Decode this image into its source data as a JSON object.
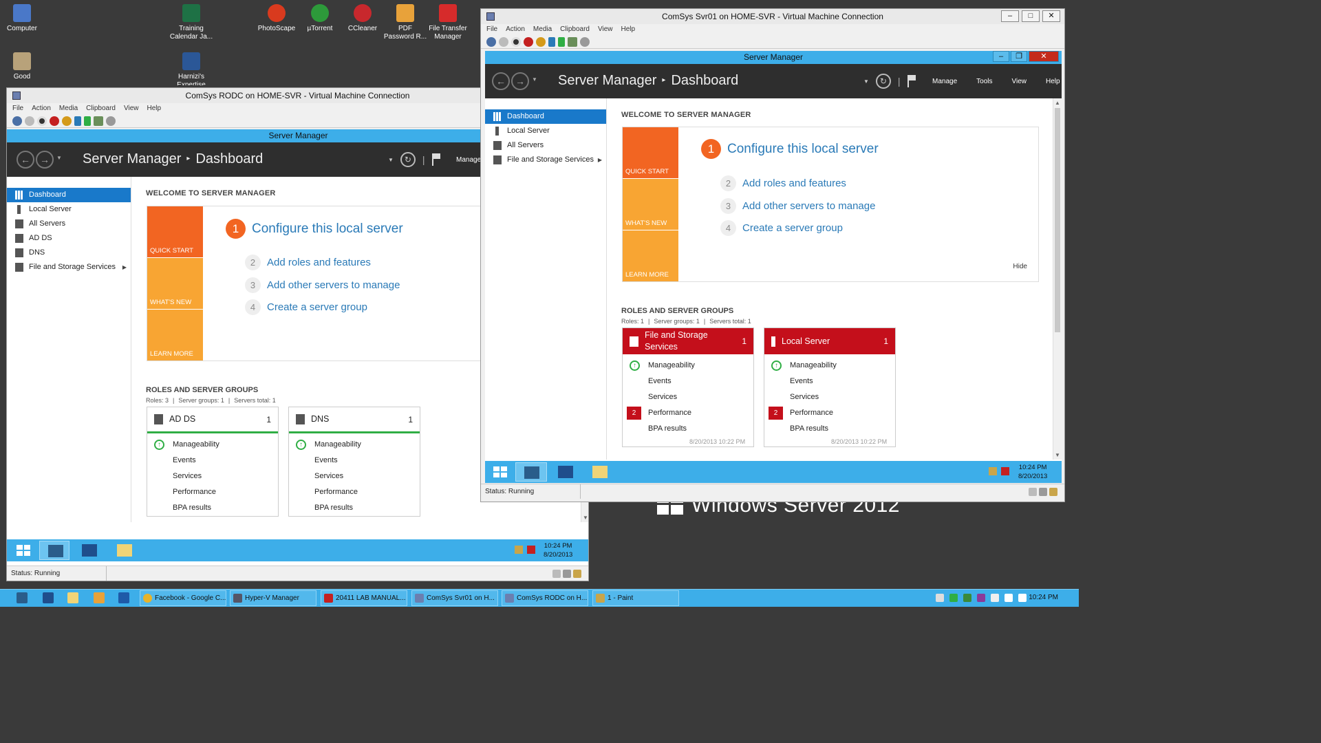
{
  "desktop": {
    "icons": [
      {
        "label": "Computer",
        "icon": "computer-icon"
      },
      {
        "label": "Training Calendar Ja...",
        "icon": "excel-file-icon"
      },
      {
        "label": "PhotoScape",
        "icon": "photoscape-icon"
      },
      {
        "label": "µTorrent",
        "icon": "utorrent-icon"
      },
      {
        "label": "CCleaner",
        "icon": "ccleaner-icon"
      },
      {
        "label": "PDF Password R...",
        "icon": "pdf-password-icon"
      },
      {
        "label": "File Transfer Manager",
        "icon": "file-transfer-icon"
      },
      {
        "label": "Good",
        "icon": "notepad-icon"
      },
      {
        "label": "Harnizi's Expertise",
        "icon": "word-file-icon"
      }
    ],
    "watermark": "Windows Server 2012"
  },
  "vm_left": {
    "title": "ComSys RODC on HOME-SVR - Virtual Machine Connection",
    "menu": [
      "File",
      "Action",
      "Media",
      "Clipboard",
      "View",
      "Help"
    ],
    "status": "Status: Running",
    "sm": {
      "title": "Server Manager",
      "breadcrumb_app": "Server Manager",
      "breadcrumb_page": "Dashboard",
      "header_menu": [
        "Manage"
      ],
      "sidebar": [
        "Dashboard",
        "Local Server",
        "All Servers",
        "AD DS",
        "DNS",
        "File and Storage Services"
      ],
      "welcome": "WELCOME TO SERVER MANAGER",
      "tiles": [
        "QUICK START",
        "WHAT'S NEW",
        "LEARN MORE"
      ],
      "steps": [
        {
          "num": "1",
          "label": "Configure this local server"
        },
        {
          "num": "2",
          "label": "Add roles and features"
        },
        {
          "num": "3",
          "label": "Add other servers to manage"
        },
        {
          "num": "4",
          "label": "Create a server group"
        }
      ],
      "roles_heading": "ROLES AND SERVER GROUPS",
      "roles_sub": [
        "Roles: 3",
        "Server groups: 1",
        "Servers total: 1"
      ],
      "cards": [
        {
          "title": "AD DS",
          "count": "1",
          "rows": [
            "Manageability",
            "Events",
            "Services",
            "Performance",
            "BPA results"
          ]
        },
        {
          "title": "DNS",
          "count": "1",
          "rows": [
            "Manageability",
            "Events",
            "Services",
            "Performance",
            "BPA results"
          ]
        }
      ]
    },
    "guest_clock": {
      "time": "10:24 PM",
      "date": "8/20/2013"
    }
  },
  "vm_right": {
    "title": "ComSys Svr01 on HOME-SVR - Virtual Machine Connection",
    "menu": [
      "File",
      "Action",
      "Media",
      "Clipboard",
      "View",
      "Help"
    ],
    "status": "Status: Running",
    "sm": {
      "title": "Server Manager",
      "breadcrumb_app": "Server Manager",
      "breadcrumb_page": "Dashboard",
      "header_menu": [
        "Manage",
        "Tools",
        "View",
        "Help"
      ],
      "sidebar": [
        "Dashboard",
        "Local Server",
        "All Servers",
        "File and Storage Services"
      ],
      "welcome": "WELCOME TO SERVER MANAGER",
      "tiles": [
        "QUICK START",
        "WHAT'S NEW",
        "LEARN MORE"
      ],
      "steps": [
        {
          "num": "1",
          "label": "Configure this local server"
        },
        {
          "num": "2",
          "label": "Add roles and features"
        },
        {
          "num": "3",
          "label": "Add other servers to manage"
        },
        {
          "num": "4",
          "label": "Create a server group"
        }
      ],
      "hide": "Hide",
      "roles_heading": "ROLES AND SERVER GROUPS",
      "roles_sub": [
        "Roles: 1",
        "Server groups: 1",
        "Servers total: 1"
      ],
      "cards": [
        {
          "title": "File and Storage Services",
          "count": "1",
          "rows": [
            "Manageability",
            "Events",
            "Services",
            "Performance",
            "BPA results"
          ],
          "perf_alert": "2",
          "timestamp": "8/20/2013 10:22 PM"
        },
        {
          "title": "Local Server",
          "count": "1",
          "rows": [
            "Manageability",
            "Events",
            "Services",
            "Performance",
            "BPA results"
          ],
          "perf_alert": "2",
          "timestamp": "8/20/2013 10:22 PM"
        }
      ]
    },
    "guest_clock": {
      "time": "10:24 PM",
      "date": "8/20/2013"
    }
  },
  "host_taskbar": {
    "tasks": [
      "Facebook - Google C...",
      "Hyper-V Manager",
      "20411 LAB MANUAL...",
      "ComSys Svr01 on H...",
      "ComSys RODC on H...",
      "1 - Paint"
    ],
    "clock": "10:24 PM"
  },
  "colors": {
    "accent_blue": "#3daee9",
    "selected_blue": "#1979ca",
    "quick_start_orange": "#f26522",
    "tile_orange": "#f8a533",
    "alert_red": "#c40f1b",
    "ok_green": "#2fae44"
  }
}
